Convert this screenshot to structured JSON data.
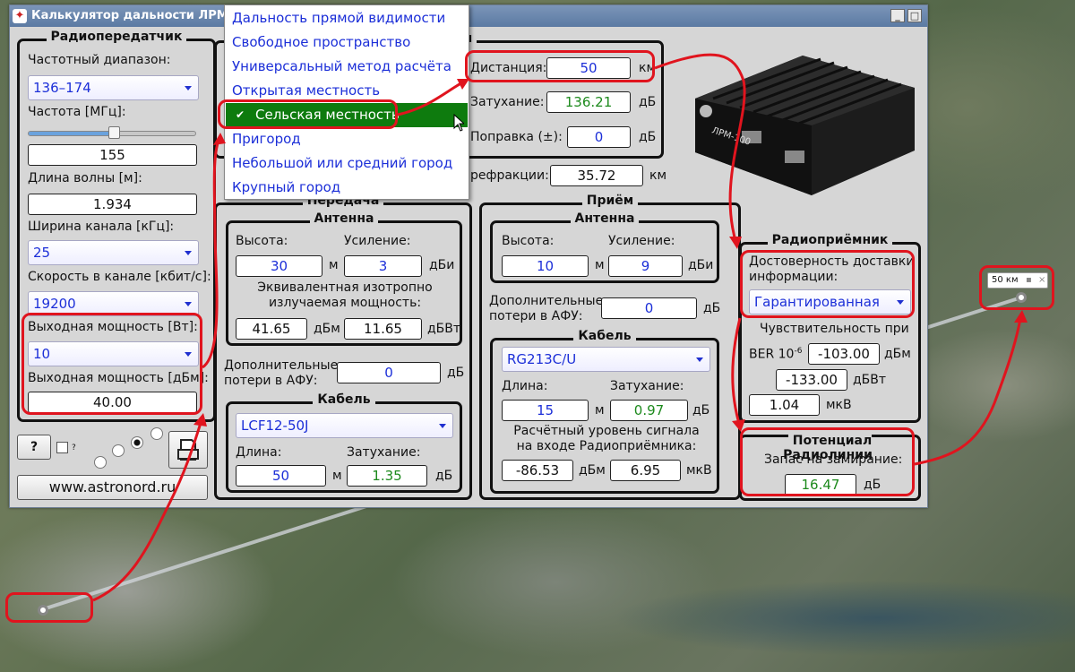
{
  "window": {
    "title": "Калькулятор дальности ЛРМ-1"
  },
  "transmitter": {
    "title": "Радиопередатчик",
    "freq_range_label": "Частотный диапазон:",
    "freq_range_value": "136–174",
    "freq_label": "Частота [МГц]:",
    "freq_value": "155",
    "freq_slider_fraction": 0.51,
    "wavelength_label": "Длина волны [м]:",
    "wavelength_value": "1.934",
    "bandwidth_label": "Ширина канала [кГц]:",
    "bandwidth_value": "25",
    "rate_label": "Скорость в канале [кбит/с]:",
    "rate_value": "19200",
    "power_w_label": "Выходная мощность [Вт]:",
    "power_w_value": "10",
    "power_dbm_label": "Выходная мощность [дБм]:",
    "power_dbm_value": "40.00"
  },
  "bottom": {
    "help_label": "?",
    "small_q": "?",
    "website": "www.astronord.ru"
  },
  "menu": {
    "items": [
      "Дальность прямой видимости",
      "Свободное пространство",
      "Универсальный метод расчёта",
      "Открытая местность",
      "Сельская местность",
      "Пригород",
      "Небольшой или средний город",
      "Крупный город"
    ],
    "selected_index": 4,
    "check": "✔"
  },
  "signal": {
    "title_tail": "л",
    "distance_label": "Дистанция:",
    "distance_value": "50",
    "distance_unit": "км",
    "attenuation_label": "Затухание:",
    "attenuation_value": "136.21",
    "attenuation_unit": "дБ",
    "correction_label": "Поправка (±):",
    "correction_value": "0",
    "correction_unit": "дБ",
    "refraction_label": "рефракции:",
    "refraction_value": "35.72",
    "refraction_unit": "км"
  },
  "tx": {
    "title": "Передача",
    "antenna_title": "Антенна",
    "height_label": "Высота:",
    "height_value": "30",
    "height_unit": "м",
    "gain_label": "Усиление:",
    "gain_value": "3",
    "gain_unit": "дБи",
    "eirp_label": "Эквивалентная изотропно излучаемая мощность:",
    "eirp_dbm": "41.65",
    "eirp_dbm_unit": "дБм",
    "eirp_dbw": "11.65",
    "eirp_dbw_unit": "дБВт",
    "afu_label": "Дополнительные потери в АФУ:",
    "afu_value": "0",
    "afu_unit": "дБ",
    "cable_title": "Кабель",
    "cable_type": "LCF12-50J",
    "len_label": "Длина:",
    "len_value": "50",
    "len_unit": "м",
    "cable_att_label": "Затухание:",
    "cable_att_value": "1.35",
    "cable_att_unit": "дБ"
  },
  "rx": {
    "title": "Приём",
    "antenna_title": "Антенна",
    "height_label": "Высота:",
    "height_value": "10",
    "height_unit": "м",
    "gain_label": "Усиление:",
    "gain_value": "9",
    "gain_unit": "дБи",
    "afu_label": "Дополнительные потери в АФУ:",
    "afu_value": "0",
    "afu_unit": "дБ",
    "cable_title": "Кабель",
    "cable_type": "RG213C/U",
    "len_label": "Длина:",
    "len_value": "15",
    "len_unit": "м",
    "cable_att_label": "Затухание:",
    "cable_att_value": "0.97",
    "cable_att_unit": "дБ",
    "level_label": "Расчётный уровень сигнала на входе Радиоприёмника:",
    "level_dbm": "-86.53",
    "level_dbm_unit": "дБм",
    "level_uv": "6.95",
    "level_uv_unit": "мкВ"
  },
  "receiver": {
    "title": "Радиоприёмник",
    "reliability_label": "Достоверность доставки информации:",
    "reliability_value": "Гарантированная",
    "sens_label": "Чувствительность при",
    "ber_label": "BER 10",
    "ber_exp": "-6",
    "sens_dbm": "-103.00",
    "sens_dbm_unit": "дБм",
    "sens_dbw": "-133.00",
    "sens_dbw_unit": "дБВт",
    "sens_uv": "1.04",
    "sens_uv_unit": "мкВ"
  },
  "potential": {
    "title": "Потенциал Радиолинии",
    "margin_label": "Запас на замирание:",
    "margin_value": "16.47",
    "margin_unit": "дБ"
  },
  "device": {
    "name": "ЛРМ-100"
  },
  "map": {
    "scale_label": "50 км"
  }
}
